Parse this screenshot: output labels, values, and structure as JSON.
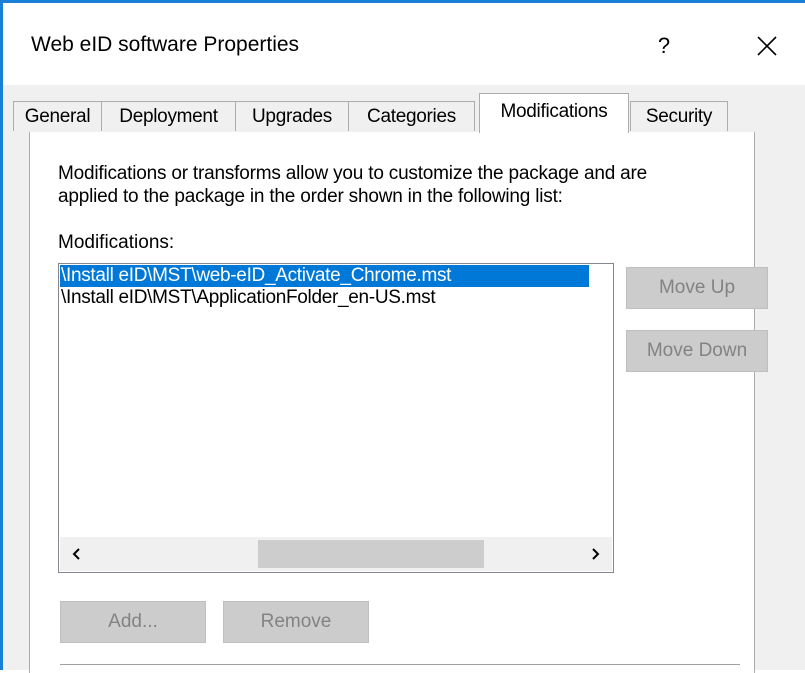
{
  "window": {
    "title": "Web eID software Properties",
    "help_label": "?",
    "accent_color": "#1a7fd6"
  },
  "tabs": [
    {
      "label": "General",
      "active": false
    },
    {
      "label": "Deployment",
      "active": false
    },
    {
      "label": "Upgrades",
      "active": false
    },
    {
      "label": "Categories",
      "active": false
    },
    {
      "label": "Modifications",
      "active": true
    },
    {
      "label": "Security",
      "active": false
    }
  ],
  "panel": {
    "description_line1": "Modifications or transforms allow you to customize the package and are",
    "description_line2": "applied to the package in the order shown in the following list:",
    "modifications_label": "Modifications:",
    "modifications": [
      {
        "path": "\\Install eID\\MST\\web-eID_Activate_Chrome.mst",
        "selected": true
      },
      {
        "path": "\\Install eID\\MST\\ApplicationFolder_en-US.mst",
        "selected": false
      }
    ],
    "selection_color": "#0078d7",
    "scroll_left_icon": "chevron-left-icon",
    "scroll_right_icon": "chevron-right-icon"
  },
  "buttons": {
    "move_up": "Move Up",
    "move_down": "Move Down",
    "add": "Add...",
    "remove": "Remove"
  },
  "icons": {
    "close": "close-icon"
  }
}
